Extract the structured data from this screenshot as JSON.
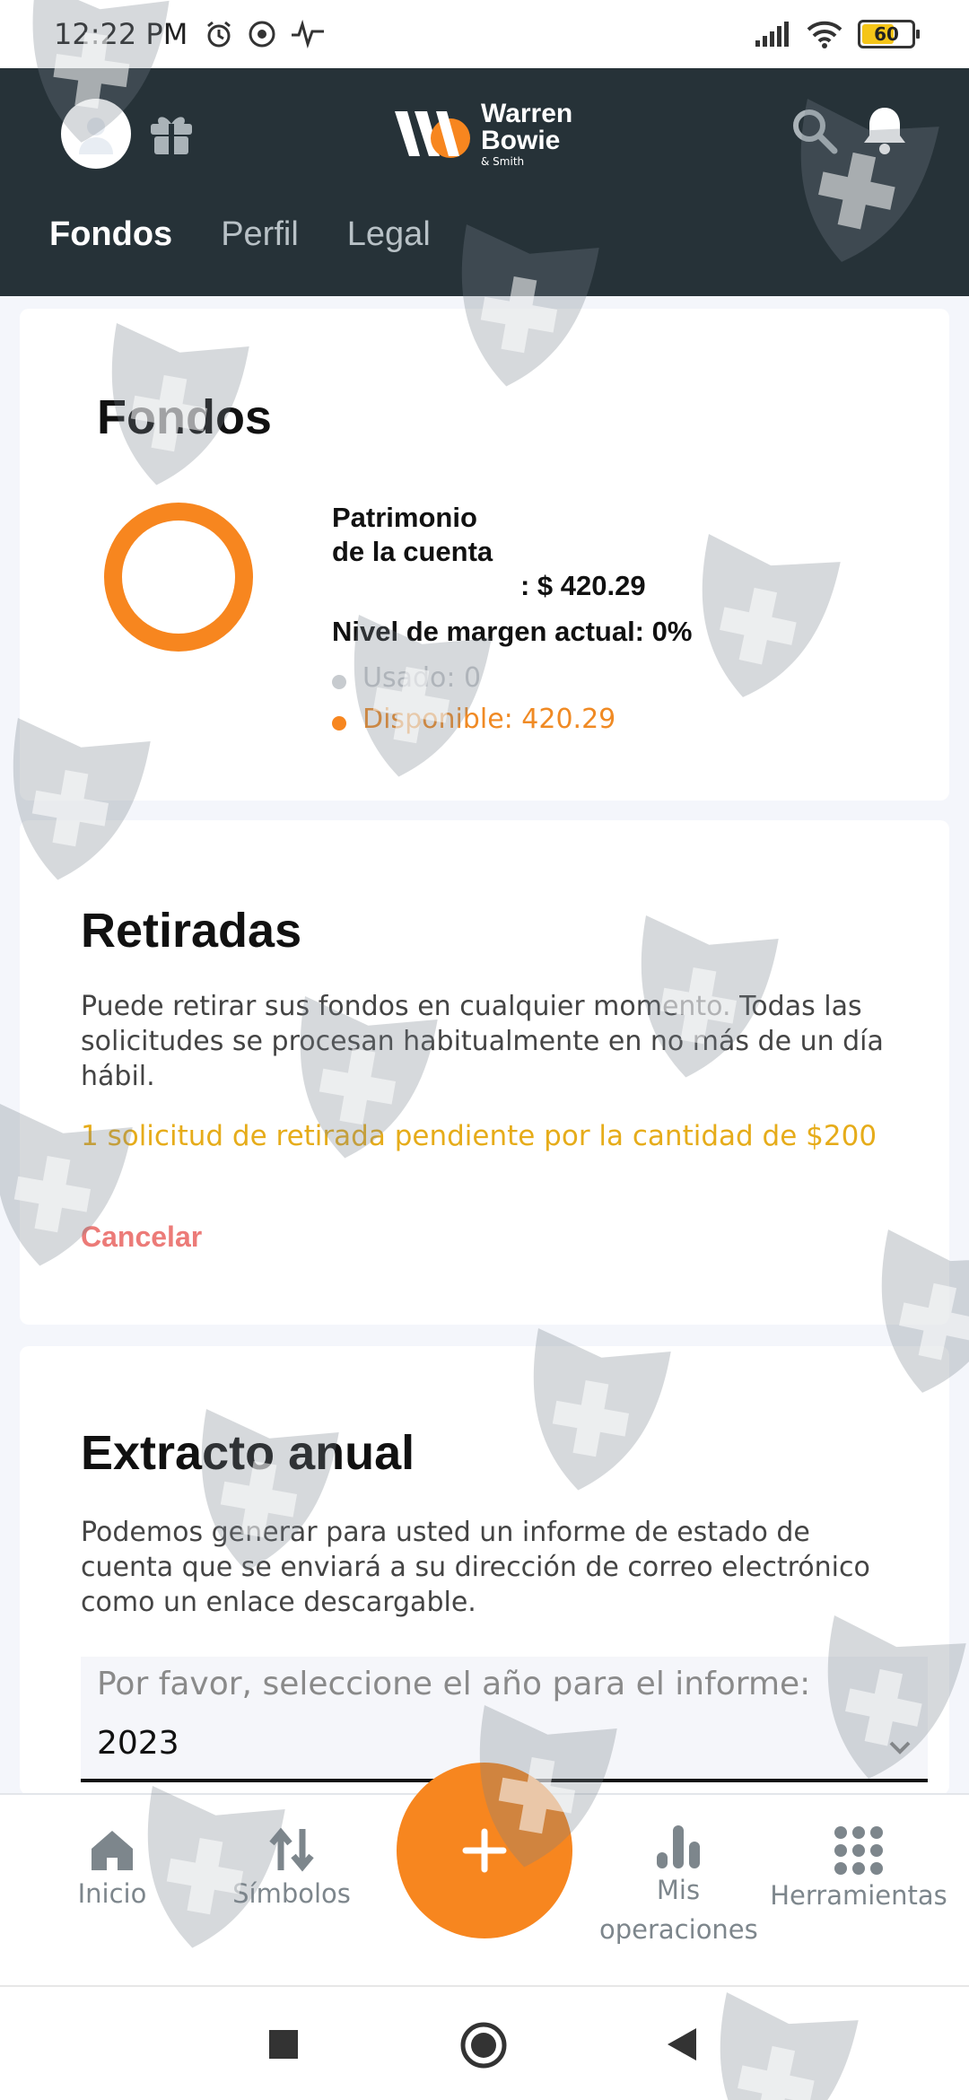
{
  "status_bar": {
    "time": "12:22 PM",
    "battery": "60"
  },
  "header": {
    "logo": {
      "line1": "Warren",
      "line2": "Bowie",
      "line3": "& Smith"
    },
    "tabs": [
      {
        "label": "Fondos",
        "active": true
      },
      {
        "label": "Perfil",
        "active": false
      },
      {
        "label": "Legal",
        "active": false
      }
    ]
  },
  "funds": {
    "title": "Fondos",
    "equity_label": "Patrimonio de la cuenta",
    "equity_value": ": $ 420.29",
    "margin_level": "Nivel de margen actual: 0%",
    "used": "Usado: 0",
    "available": "Disponible: 420.29",
    "ring_color": "#f7861f",
    "used_fraction": 0
  },
  "withdrawals": {
    "title": "Retiradas",
    "description": "Puede retirar sus fondos en cualquier momento. Todas las solicitudes se procesan habitualmente en no más de un día hábil.",
    "pending": "1 solicitud de retirada pendiente por la cantidad de $200",
    "cancel_label": "Cancelar"
  },
  "statement": {
    "title": "Extracto anual",
    "description": "Podemos generar para usted un informe de estado de cuenta que se enviará a su dirección de correo electrónico como un enlace descargable.",
    "select_label": "Por favor, seleccione el año para el informe:",
    "select_value": "2023"
  },
  "bottom_nav": {
    "items": [
      {
        "label": "Inicio",
        "icon": "home-icon"
      },
      {
        "label": "Símbolos",
        "icon": "swap-arrows-icon"
      },
      {
        "label": "Mis operaciones",
        "icon": "bar-chart-icon"
      },
      {
        "label": "Herramientas",
        "icon": "grid-dots-icon"
      }
    ],
    "fab_icon": "plus-icon"
  },
  "colors": {
    "header_bg": "#263238",
    "accent": "#f7861f",
    "pending": "#e6ac1a",
    "cancel": "#ec7b78"
  }
}
